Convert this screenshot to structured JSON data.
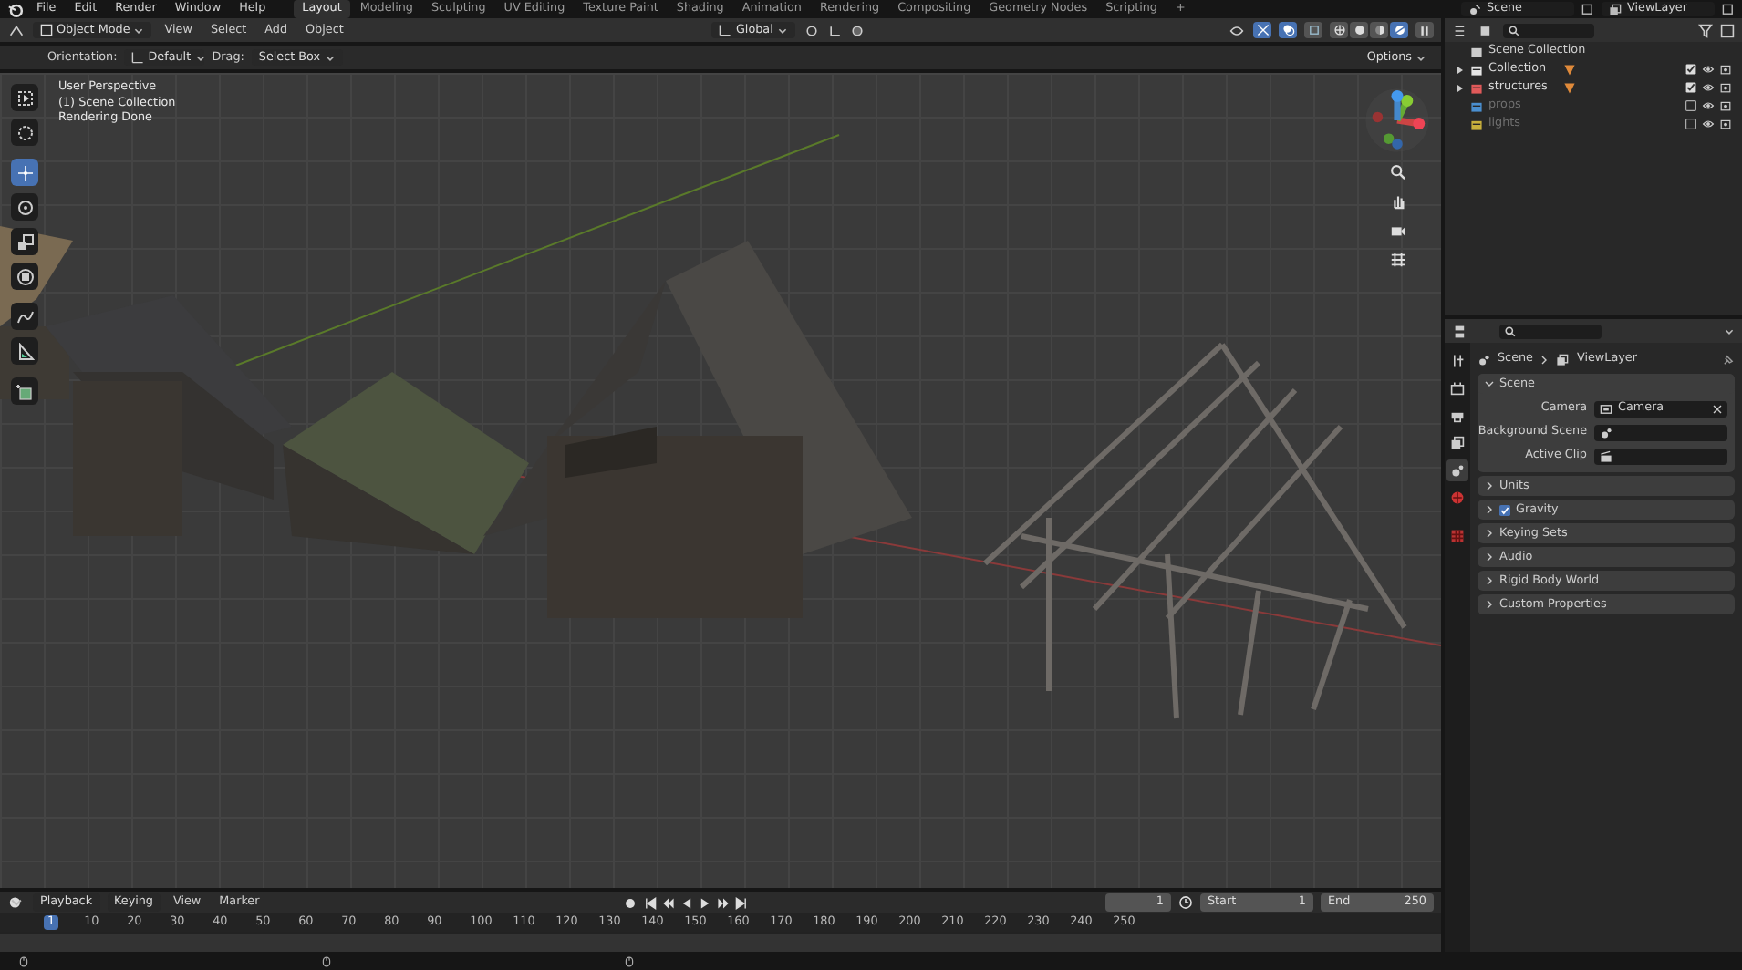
{
  "top_bar": {
    "menus": [
      "File",
      "Edit",
      "Render",
      "Window",
      "Help"
    ],
    "workspaces": [
      {
        "label": "Layout",
        "selected": true
      },
      {
        "label": "Modeling",
        "selected": false
      },
      {
        "label": "Sculpting",
        "selected": false
      },
      {
        "label": "UV Editing",
        "selected": false
      },
      {
        "label": "Texture Paint",
        "selected": false
      },
      {
        "label": "Shading",
        "selected": false
      },
      {
        "label": "Animation",
        "selected": false
      },
      {
        "label": "Rendering",
        "selected": false
      },
      {
        "label": "Compositing",
        "selected": false
      },
      {
        "label": "Geometry Nodes",
        "selected": false
      },
      {
        "label": "Scripting",
        "selected": false
      }
    ],
    "add_workspace": "+",
    "scene": "Scene",
    "view_layer": "ViewLayer"
  },
  "viewport": {
    "mode": "Object Mode",
    "menus": [
      "View",
      "Select",
      "Add",
      "Object"
    ],
    "orientation": "Global",
    "shading": [
      {
        "kind": "wireframe",
        "selected": false
      },
      {
        "kind": "solid",
        "selected": false
      },
      {
        "kind": "material",
        "selected": false
      },
      {
        "kind": "rendered",
        "selected": true
      }
    ],
    "options": "Options",
    "tool_settings": {
      "orientation_label": "Orientation:",
      "orientation": "Default",
      "drag_label": "Drag:",
      "drag": "Select Box"
    },
    "info": [
      "User Perspective",
      "(1) Scene Collection",
      "Rendering Done"
    ],
    "tools": [
      {
        "kind": "select",
        "selected": false
      },
      {
        "kind": "cursor",
        "selected": false
      },
      {
        "kind": "move",
        "selected": true
      },
      {
        "kind": "rotate",
        "selected": false
      },
      {
        "kind": "scale",
        "selected": false
      },
      {
        "kind": "transform",
        "selected": false
      },
      {
        "kind": "annotate",
        "selected": false
      },
      {
        "kind": "measure",
        "selected": false
      },
      {
        "kind": "add_cube",
        "selected": false
      }
    ]
  },
  "outliner": {
    "root": "Scene Collection",
    "collections": [
      {
        "name": "Collection",
        "color": "#e6e6e6",
        "expanded": false,
        "checked": true
      },
      {
        "name": "structures",
        "color": "#e05a5a",
        "expanded": false,
        "checked": true
      },
      {
        "name": "props",
        "color": "#4a8fd0",
        "checked": false
      },
      {
        "name": "lights",
        "color": "#c8b03c",
        "checked": false
      }
    ]
  },
  "properties": {
    "tabs": [
      {
        "kind": "tool",
        "selected": false
      },
      {
        "kind": "render",
        "selected": false
      },
      {
        "kind": "output",
        "selected": false
      },
      {
        "kind": "view_layer",
        "selected": false
      },
      {
        "kind": "scene",
        "selected": true
      },
      {
        "kind": "world",
        "selected": false
      },
      {
        "kind": "collection",
        "selected": false
      }
    ],
    "breadcrumb": [
      "Scene",
      "ViewLayer"
    ],
    "panel": {
      "title": "Scene",
      "expanded": true,
      "fields": [
        {
          "label": "Camera",
          "value": "Camera"
        },
        {
          "label": "Background Scene"
        },
        {
          "label": "Active Clip"
        }
      ]
    },
    "subpanels": [
      {
        "title": "Units"
      },
      {
        "title": "Gravity",
        "checked": true
      },
      {
        "title": "Keying Sets"
      },
      {
        "title": "Audio"
      },
      {
        "title": "Rigid Body World"
      },
      {
        "title": "Custom Properties"
      }
    ]
  },
  "timeline": {
    "menus": [
      "Playback",
      "Keying",
      "View",
      "Marker"
    ],
    "current_frame": "1",
    "start_label": "Start",
    "start": "1",
    "end_label": "End",
    "end": "250",
    "ruler": [
      {
        "label": "1",
        "selected": true
      },
      {
        "label": "10",
        "selected": false
      },
      {
        "label": "20",
        "selected": false
      },
      {
        "label": "30",
        "selected": false
      },
      {
        "label": "40",
        "selected": false
      },
      {
        "label": "50",
        "selected": false
      },
      {
        "label": "60",
        "selected": false
      },
      {
        "label": "70",
        "selected": false
      },
      {
        "label": "80",
        "selected": false
      },
      {
        "label": "90",
        "selected": false
      },
      {
        "label": "100",
        "selected": false
      },
      {
        "label": "110",
        "selected": false
      },
      {
        "label": "120",
        "selected": false
      },
      {
        "label": "130",
        "selected": false
      },
      {
        "label": "140",
        "selected": false
      },
      {
        "label": "150",
        "selected": false
      },
      {
        "label": "160",
        "selected": false
      },
      {
        "label": "170",
        "selected": false
      },
      {
        "label": "180",
        "selected": false
      },
      {
        "label": "190",
        "selected": false
      },
      {
        "label": "200",
        "selected": false
      },
      {
        "label": "210",
        "selected": false
      },
      {
        "label": "220",
        "selected": false
      },
      {
        "label": "230",
        "selected": false
      },
      {
        "label": "240",
        "selected": false
      },
      {
        "label": "250",
        "selected": false
      }
    ]
  }
}
